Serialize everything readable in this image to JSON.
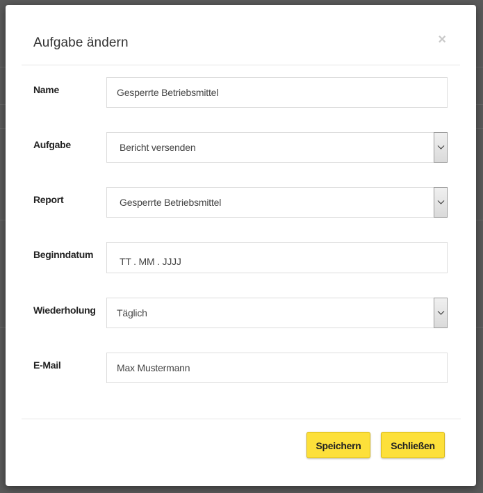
{
  "modal": {
    "title": "Aufgabe ändern",
    "close_symbol": "×"
  },
  "form": {
    "name": {
      "label": "Name",
      "value": "Gesperrte Betriebsmittel"
    },
    "task": {
      "label": "Aufgabe",
      "value": "Bericht versenden"
    },
    "report": {
      "label": "Report",
      "value": "Gesperrte Betriebsmittel"
    },
    "start_date": {
      "label": "Beginndatum",
      "value": "TT . MM . JJJJ"
    },
    "repeat": {
      "label": "Wiederholung",
      "value": "Täglich"
    },
    "email": {
      "label": "E-Mail",
      "value": "Max Mustermann"
    }
  },
  "footer": {
    "save_label": "Speichern",
    "close_label": "Schließen"
  },
  "colors": {
    "button_accent": "#fde03a",
    "backdrop": "#5a5a5a"
  }
}
